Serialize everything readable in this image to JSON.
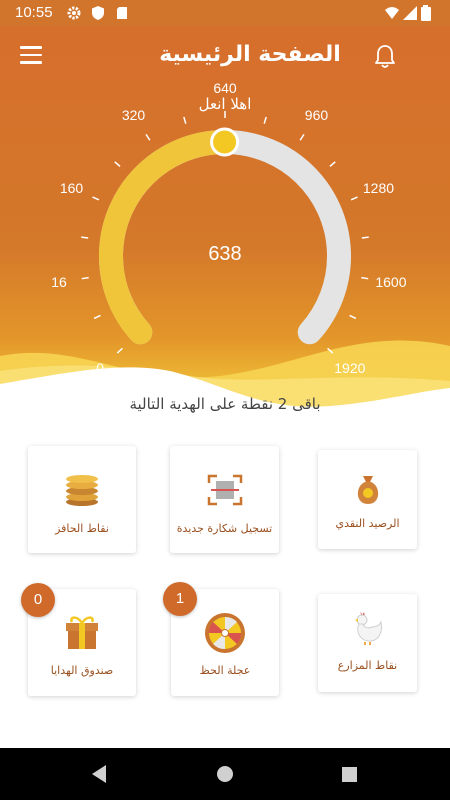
{
  "status_bar": {
    "time": "10:55",
    "icons": [
      "settings-icon",
      "shield-icon",
      "sd-card-icon",
      "wifi-icon",
      "signal-icon",
      "battery-icon"
    ]
  },
  "header": {
    "title": "الصفحة الرئيسية",
    "icons": [
      "menu-icon",
      "bell-icon"
    ]
  },
  "greeting": "اهلا انعل",
  "gauge": {
    "value": "638",
    "min": 0,
    "max": 1920,
    "current": 638,
    "tick_labels": [
      "0",
      "16",
      "160",
      "320",
      "640",
      "960",
      "1280",
      "1600",
      "1920"
    ]
  },
  "next_gift_text": "باقى 2 نقطة على الهدية التالية",
  "cards": {
    "cash_balance": {
      "label": "الرصيد النقدي",
      "icon": "money-bag-icon"
    },
    "register_card": {
      "label": "تسجيل شكارة جديدة",
      "icon": "scan-icon"
    },
    "incentive_points": {
      "label": "نقاط الحافز",
      "icon": "coins-icon"
    },
    "farmer_points": {
      "label": "نقاط المزارع",
      "icon": "chicken-icon"
    },
    "wheel_of_luck": {
      "label": "عجلة الحظ",
      "icon": "wheel-icon",
      "badge": "1"
    },
    "gift_box": {
      "label": "صندوق الهدايا",
      "icon": "gift-icon",
      "badge": "0"
    }
  },
  "colors": {
    "primary": "#d4742c",
    "gauge_fill": "#f0c53a",
    "gauge_track": "#e4e4e4",
    "badge": "#d06a2b",
    "label": "#9a4f1e"
  },
  "nav_bar": {
    "icons": [
      "back-icon",
      "home-icon",
      "recents-icon"
    ]
  }
}
